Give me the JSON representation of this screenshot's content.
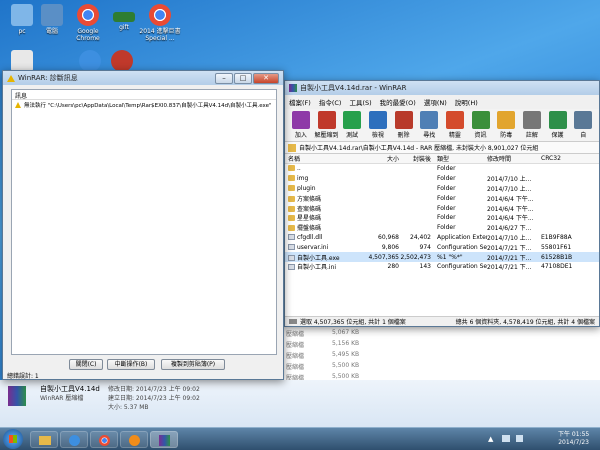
{
  "desktop": {
    "icons": [
      {
        "label": "pc",
        "color": "#7fb6e8"
      },
      {
        "label": "電腦",
        "color": "#5a8fc6"
      },
      {
        "label": "Google Chrome",
        "color": "#e94b35"
      },
      {
        "label": "gift",
        "color": "#2e7d32"
      },
      {
        "label": "2014 進擊巨書Special ...",
        "color": "#e94b35"
      },
      {
        "label": "",
        "color": "#e8e8e8"
      },
      {
        "label": "",
        "color": "#3d8fe0"
      },
      {
        "label": "",
        "color": "#c0392b"
      }
    ]
  },
  "error_window": {
    "title": "WinRAR: 診斷訊息",
    "header": "訊息",
    "message": "無法執行 \"C:\\Users\\pc\\AppData\\Local\\Temp\\Rar$EXI0.837\\自製小工具V4.14d\\自製小工具.exe\"",
    "buttons": {
      "close": "關閉(C)",
      "break": "中斷操作(B)",
      "copy": "複製到剪貼簿(P)"
    },
    "total_errors": "總錯誤計: 1"
  },
  "winrar": {
    "title": "自製小工具V4.14d.rar - WinRAR",
    "menu": [
      "檔案(F)",
      "指令(C)",
      "工具(S)",
      "我的最愛(O)",
      "選項(N)",
      "說明(H)"
    ],
    "toolbar": [
      "加入",
      "解壓縮到",
      "測試",
      "檢視",
      "刪除",
      "尋找",
      "精靈",
      "資訊",
      "防毒",
      "註解",
      "保護",
      "自"
    ],
    "address": "自製小工具V4.14d.rar\\自製小工具V4.14d - RAR 壓縮檔, 未封裝大小 8,901,027 位元組",
    "columns": [
      "名稱",
      "大小",
      "封裝後",
      "類型",
      "修改時間",
      "CRC32"
    ],
    "files": [
      {
        "name": "..",
        "size": "",
        "packed": "",
        "type": "Folder",
        "modified": "",
        "crc": "",
        "kind": "folder"
      },
      {
        "name": "img",
        "size": "",
        "packed": "",
        "type": "Folder",
        "modified": "2014/7/10 上...",
        "crc": "",
        "kind": "folder"
      },
      {
        "name": "plugin",
        "size": "",
        "packed": "",
        "type": "Folder",
        "modified": "2014/7/10 上...",
        "crc": "",
        "kind": "folder"
      },
      {
        "name": "方案條碼",
        "size": "",
        "packed": "",
        "type": "Folder",
        "modified": "2014/6/4 下午...",
        "crc": "",
        "kind": "folder"
      },
      {
        "name": "查案條碼",
        "size": "",
        "packed": "",
        "type": "Folder",
        "modified": "2014/6/4 下午...",
        "crc": "",
        "kind": "folder"
      },
      {
        "name": "星星條碼",
        "size": "",
        "packed": "",
        "type": "Folder",
        "modified": "2014/6/4 下午...",
        "crc": "",
        "kind": "folder"
      },
      {
        "name": "擺盤條碼",
        "size": "",
        "packed": "",
        "type": "Folder",
        "modified": "2014/6/27 下...",
        "crc": "",
        "kind": "folder"
      },
      {
        "name": "cfgdll.dll",
        "size": "60,968",
        "packed": "24,402",
        "type": "Application Exten...",
        "modified": "2014/7/10 上...",
        "crc": "E1B9F88A",
        "kind": "file"
      },
      {
        "name": "uservar.ini",
        "size": "9,806",
        "packed": "974",
        "type": "Configuration Set...",
        "modified": "2014/7/21 下...",
        "crc": "55801F61",
        "kind": "file"
      },
      {
        "name": "自製小工具.exe",
        "size": "4,507,365",
        "packed": "2,502,473",
        "type": "%1 \"%*\"",
        "modified": "2014/7/21 下...",
        "crc": "61528B1B",
        "kind": "file"
      },
      {
        "name": "自製小工具.ini",
        "size": "280",
        "packed": "143",
        "type": "Configuration Set...",
        "modified": "2014/7/21 下...",
        "crc": "47108DE1",
        "kind": "file"
      }
    ],
    "status_left": "選取 4,507,365 位元組, 共計 1 個檔案",
    "status_right": "總共 6 個資料夾, 4,578,419 位元組, 共計 4 個檔案"
  },
  "background_list": {
    "rows": [
      {
        "type": "壓縮檔",
        "size": "5,067 KB"
      },
      {
        "type": "壓縮檔",
        "size": "5,156 KB"
      },
      {
        "type": "壓縮檔",
        "size": "5,495 KB"
      },
      {
        "type": "壓縮檔",
        "size": "5,500 KB"
      },
      {
        "type": "壓縮檔",
        "size": "5,500 KB"
      }
    ],
    "selected_file": {
      "name": "自製小工具V4.14d",
      "modified": "修改日期: 2014/7/23 上午 09:02",
      "created": "建立日期: 2014/7/23 上午 09:02",
      "app": "WinRAR 壓縮檔",
      "size": "大小: 5.37 MB"
    }
  },
  "taskbar": {
    "time": "下午 01:55",
    "date": "2014/7/23"
  }
}
